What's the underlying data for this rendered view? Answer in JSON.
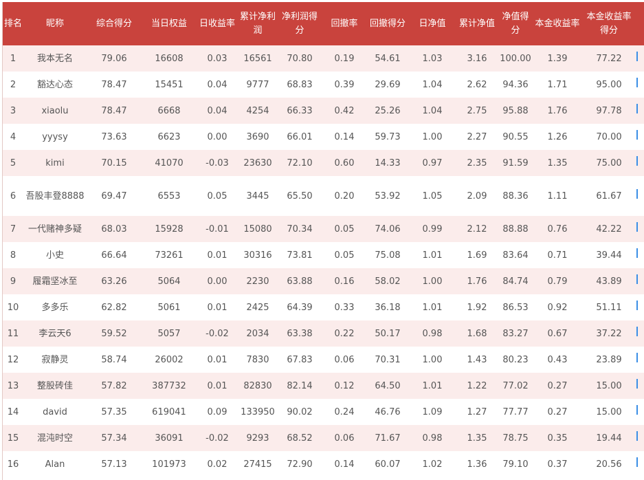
{
  "headers": [
    "排名",
    "昵称",
    "综合得分",
    "当日权益",
    "日收益率",
    "累计净利润",
    "净利润得分",
    "回撤率",
    "回撤得分",
    "日净值",
    "累计净值",
    "净值得分",
    "本金收益率",
    "本金收益率得分"
  ],
  "rows": [
    {
      "rank": "1",
      "name": "我本无名",
      "score": "79.06",
      "equity": "16608",
      "daily_return": "0.03",
      "cum_profit": "16561",
      "profit_score": "70.80",
      "drawdown": "0.19",
      "drawdown_score": "54.61",
      "daily_nav": "1.03",
      "cum_nav": "3.16",
      "nav_score": "100.00",
      "principal_return": "1.39",
      "principal_score": "77.22"
    },
    {
      "rank": "2",
      "name": "豁达心态",
      "score": "78.47",
      "equity": "15451",
      "daily_return": "0.04",
      "cum_profit": "9777",
      "profit_score": "68.83",
      "drawdown": "0.39",
      "drawdown_score": "29.69",
      "daily_nav": "1.04",
      "cum_nav": "2.62",
      "nav_score": "94.36",
      "principal_return": "1.71",
      "principal_score": "95.00"
    },
    {
      "rank": "3",
      "name": "xiaolu",
      "score": "78.47",
      "equity": "6668",
      "daily_return": "0.04",
      "cum_profit": "4254",
      "profit_score": "66.33",
      "drawdown": "0.42",
      "drawdown_score": "25.26",
      "daily_nav": "1.04",
      "cum_nav": "2.75",
      "nav_score": "95.88",
      "principal_return": "1.76",
      "principal_score": "97.78"
    },
    {
      "rank": "4",
      "name": "yyysy",
      "score": "73.63",
      "equity": "6623",
      "daily_return": "0.00",
      "cum_profit": "3690",
      "profit_score": "66.01",
      "drawdown": "0.14",
      "drawdown_score": "59.73",
      "daily_nav": "1.00",
      "cum_nav": "2.27",
      "nav_score": "90.55",
      "principal_return": "1.26",
      "principal_score": "70.00"
    },
    {
      "rank": "5",
      "name": "kimi",
      "score": "70.15",
      "equity": "41070",
      "daily_return": "-0.03",
      "cum_profit": "23630",
      "profit_score": "72.10",
      "drawdown": "0.60",
      "drawdown_score": "14.33",
      "daily_nav": "0.97",
      "cum_nav": "2.35",
      "nav_score": "91.59",
      "principal_return": "1.35",
      "principal_score": "75.00"
    },
    {
      "rank": "6",
      "name": "吾股丰登8888",
      "score": "69.47",
      "equity": "6553",
      "daily_return": "0.05",
      "cum_profit": "3445",
      "profit_score": "65.50",
      "drawdown": "0.20",
      "drawdown_score": "53.92",
      "daily_nav": "1.05",
      "cum_nav": "2.09",
      "nav_score": "88.36",
      "principal_return": "1.11",
      "principal_score": "61.67"
    },
    {
      "rank": "7",
      "name": "一代赌神多疑",
      "score": "68.03",
      "equity": "15928",
      "daily_return": "-0.01",
      "cum_profit": "15080",
      "profit_score": "70.34",
      "drawdown": "0.05",
      "drawdown_score": "74.06",
      "daily_nav": "0.99",
      "cum_nav": "2.12",
      "nav_score": "88.88",
      "principal_return": "0.76",
      "principal_score": "42.22"
    },
    {
      "rank": "8",
      "name": "小史",
      "score": "66.64",
      "equity": "73261",
      "daily_return": "0.01",
      "cum_profit": "30316",
      "profit_score": "73.81",
      "drawdown": "0.05",
      "drawdown_score": "75.08",
      "daily_nav": "1.01",
      "cum_nav": "1.69",
      "nav_score": "83.64",
      "principal_return": "0.71",
      "principal_score": "39.44"
    },
    {
      "rank": "9",
      "name": "履霜坚冰至",
      "score": "63.26",
      "equity": "5064",
      "daily_return": "0.00",
      "cum_profit": "2230",
      "profit_score": "63.88",
      "drawdown": "0.16",
      "drawdown_score": "58.02",
      "daily_nav": "1.00",
      "cum_nav": "1.76",
      "nav_score": "84.74",
      "principal_return": "0.79",
      "principal_score": "43.89"
    },
    {
      "rank": "10",
      "name": "多多乐",
      "score": "62.82",
      "equity": "5061",
      "daily_return": "0.01",
      "cum_profit": "2425",
      "profit_score": "64.39",
      "drawdown": "0.33",
      "drawdown_score": "36.18",
      "daily_nav": "1.01",
      "cum_nav": "1.92",
      "nav_score": "86.53",
      "principal_return": "0.92",
      "principal_score": "51.11"
    },
    {
      "rank": "11",
      "name": "李云天6",
      "score": "59.52",
      "equity": "5057",
      "daily_return": "-0.02",
      "cum_profit": "2034",
      "profit_score": "63.38",
      "drawdown": "0.22",
      "drawdown_score": "50.17",
      "daily_nav": "0.98",
      "cum_nav": "1.68",
      "nav_score": "83.27",
      "principal_return": "0.67",
      "principal_score": "37.22"
    },
    {
      "rank": "12",
      "name": "寂静灵",
      "score": "58.74",
      "equity": "26002",
      "daily_return": "0.01",
      "cum_profit": "7830",
      "profit_score": "67.83",
      "drawdown": "0.06",
      "drawdown_score": "70.31",
      "daily_nav": "1.00",
      "cum_nav": "1.43",
      "nav_score": "80.23",
      "principal_return": "0.43",
      "principal_score": "23.89"
    },
    {
      "rank": "13",
      "name": "整股砖佳",
      "score": "57.82",
      "equity": "387732",
      "daily_return": "0.01",
      "cum_profit": "82830",
      "profit_score": "82.14",
      "drawdown": "0.12",
      "drawdown_score": "64.50",
      "daily_nav": "1.01",
      "cum_nav": "1.22",
      "nav_score": "77.02",
      "principal_return": "0.27",
      "principal_score": "15.00"
    },
    {
      "rank": "14",
      "name": "david",
      "score": "57.35",
      "equity": "619041",
      "daily_return": "0.09",
      "cum_profit": "133950",
      "profit_score": "90.02",
      "drawdown": "0.24",
      "drawdown_score": "46.76",
      "daily_nav": "1.09",
      "cum_nav": "1.27",
      "nav_score": "77.77",
      "principal_return": "0.27",
      "principal_score": "15.00"
    },
    {
      "rank": "15",
      "name": "混沌时空",
      "score": "57.34",
      "equity": "36091",
      "daily_return": "-0.02",
      "cum_profit": "9293",
      "profit_score": "68.52",
      "drawdown": "0.06",
      "drawdown_score": "71.67",
      "daily_nav": "0.98",
      "cum_nav": "1.35",
      "nav_score": "78.75",
      "principal_return": "0.35",
      "principal_score": "19.44"
    },
    {
      "rank": "16",
      "name": "Alan",
      "score": "57.13",
      "equity": "101973",
      "daily_return": "0.02",
      "cum_profit": "27415",
      "profit_score": "72.90",
      "drawdown": "0.14",
      "drawdown_score": "60.07",
      "daily_nav": "1.02",
      "cum_nav": "1.36",
      "nav_score": "79.10",
      "principal_return": "0.37",
      "principal_score": "20.56"
    }
  ]
}
